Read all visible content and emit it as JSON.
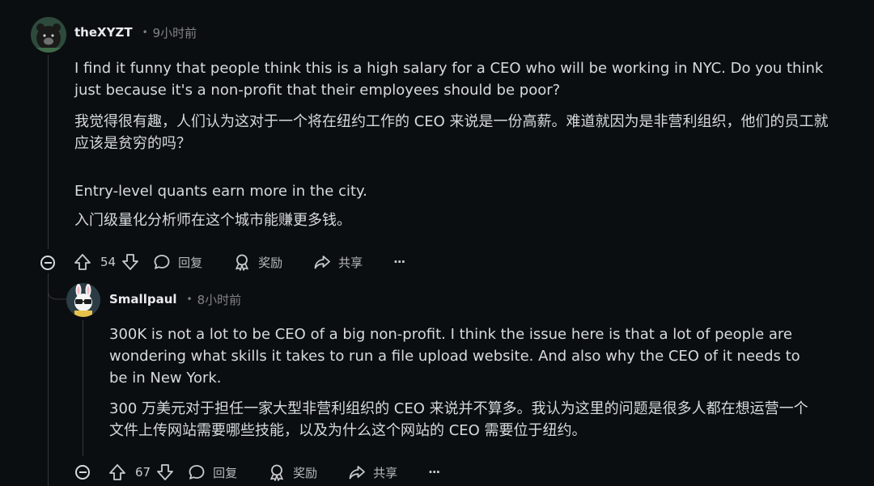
{
  "comment1": {
    "username": "theXYZT",
    "time": "9小时前",
    "paragraphs": [
      "I find it funny that people think this is a high salary for a CEO who will be working in NYC. Do you think just because it's a non-profit that their employees should be poor?",
      "我觉得很有趣，人们认为这对于一个将在纽约工作的 CEO 来说是一份高薪。难道就因为是非营利组织，他们的员工就应该是贫穷的吗？",
      "Entry-level quants earn more in the city.",
      "入门级量化分析师在这个城市能赚更多钱。"
    ],
    "votes": "54",
    "reply_label": "回复",
    "award_label": "奖励",
    "share_label": "共享",
    "more_label": "···"
  },
  "comment2": {
    "username": "Smallpaul",
    "time": "8小时前",
    "paragraphs": [
      "300K is not a lot to be CEO of a big non-profit. I think the issue here is that a lot of people are wondering what skills it takes to run a file upload website. And also why the CEO of it needs to be in New York.",
      "300 万美元对于担任一家大型非营利组织的 CEO 来说并不算多。我认为这里的问题是很多人都在想运营一个文件上传网站需要哪些技能，以及为什么这个网站的 CEO 需要位于纽约。"
    ],
    "votes": "67",
    "reply_label": "回复",
    "award_label": "奖励",
    "share_label": "共享",
    "more_label": "···"
  },
  "icons": [
    "avatar-bear",
    "avatar-bunny",
    "upvote-icon",
    "downvote-icon",
    "reply-icon",
    "award-icon",
    "share-icon",
    "more-icon",
    "collapse-icon"
  ],
  "colors": {
    "background": "#0b0e10",
    "text": "#d7dadc",
    "muted": "#818384",
    "thread": "#343536"
  }
}
